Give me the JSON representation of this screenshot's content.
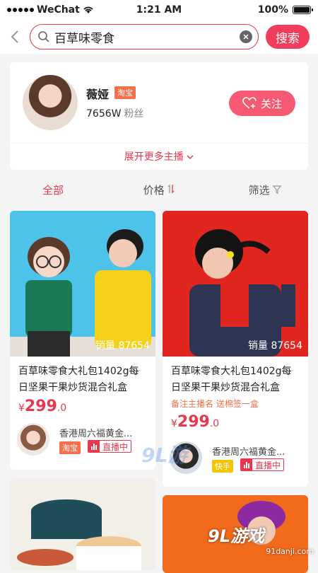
{
  "status": {
    "carrier": "WeChat",
    "time": "1:21 AM",
    "battery": "100%",
    "battery_level": 1.0
  },
  "search": {
    "query": "百草味零食",
    "button_label": "搜索"
  },
  "anchor": {
    "name": "薇娅",
    "platform": "淘宝",
    "fans_count": "7656W",
    "fans_label": "粉丝",
    "follow_label": "关注",
    "expand_label": "展开更多主播"
  },
  "tabs": [
    {
      "label": "全部"
    },
    {
      "label": "价格"
    },
    {
      "label": "筛选"
    }
  ],
  "products": [
    {
      "sales": "销量 87654",
      "title": "百草味零食大礼包1402g每日坚果干果炒货混合礼盒",
      "price_symbol": "¥",
      "price_int": "299",
      "price_dec": ".0",
      "seller": "香港周六福黄金...",
      "platform": "淘宝",
      "live": "直播中"
    },
    {
      "sales": "销量 87654",
      "title": "百草味零食大礼包1402g每日坚果干果炒货混合礼盒",
      "remark": "备注主播名 送棉签一盒",
      "price_symbol": "¥",
      "price_int": "299",
      "price_dec": ".0",
      "seller": "香港周六福黄金...",
      "platform": "快手",
      "live": "直播中"
    }
  ],
  "watermark": {
    "logo": "9L游戏",
    "url": "91danji.com",
    "mid": "9L游"
  },
  "colors": {
    "accent": "#e8384f",
    "follow": "#f55a72",
    "taobao": "#f5704a",
    "kuaishou": "#f5c400"
  }
}
